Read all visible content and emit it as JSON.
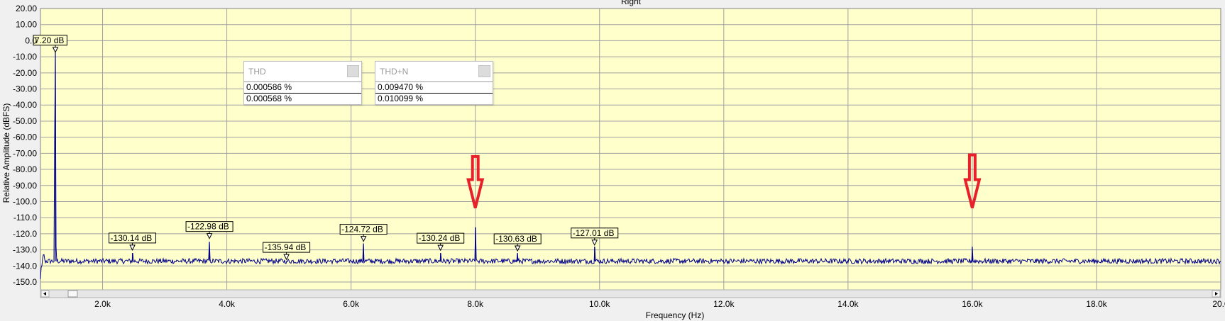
{
  "chart_data": {
    "type": "line",
    "title": "Right",
    "xlabel": "Frequency (Hz)",
    "ylabel": "Relative Amplitude (dBFS)",
    "xlim": [
      1000,
      20000
    ],
    "ylim": [
      -150,
      20
    ],
    "grid": true,
    "x_ticks": [
      2000,
      4000,
      6000,
      8000,
      10000,
      12000,
      14000,
      16000,
      18000,
      20000
    ],
    "x_tick_labels": [
      "2.0k",
      "4.0k",
      "6.0k",
      "8.0k",
      "10.0k",
      "12.0k",
      "14.0k",
      "16.0k",
      "18.0k",
      "20.0"
    ],
    "y_ticks": [
      20,
      10,
      0,
      -10,
      -20,
      -30,
      -40,
      -50,
      -60,
      -70,
      -80,
      -90,
      -100,
      -110,
      -120,
      -130,
      -140,
      -150
    ],
    "y_tick_labels": [
      "20.00",
      "10.00",
      "0.0",
      "-10.00",
      "-20.00",
      "-30.00",
      "-40.00",
      "-50.00",
      "-60.00",
      "-70.00",
      "-80.00",
      "-90.00",
      "-100.0",
      "-110.0",
      "-120.0",
      "-130.0",
      "-140.0",
      "-150.0"
    ],
    "noise_floor": -137,
    "series": [
      {
        "color": "#00008b",
        "peaks": [
          {
            "x": 1240,
            "y": -7.2
          },
          {
            "x": 2480,
            "y": -132
          },
          {
            "x": 3720,
            "y": -125
          },
          {
            "x": 4960,
            "y": -137
          },
          {
            "x": 6200,
            "y": -126
          },
          {
            "x": 7440,
            "y": -132
          },
          {
            "x": 8000,
            "y": -116
          },
          {
            "x": 8680,
            "y": -132
          },
          {
            "x": 9920,
            "y": -128
          },
          {
            "x": 16000,
            "y": -128
          }
        ]
      }
    ],
    "peak_labels": [
      {
        "x": 1240,
        "y": -7.2,
        "text": "7.20 dB"
      },
      {
        "x": 2480,
        "y": -130.14,
        "text": "-130.14 dB"
      },
      {
        "x": 3720,
        "y": -122.98,
        "text": "-122.98 dB"
      },
      {
        "x": 4960,
        "y": -135.94,
        "text": "-135.94 dB"
      },
      {
        "x": 6200,
        "y": -124.72,
        "text": "-124.72 dB"
      },
      {
        "x": 7440,
        "y": -130.24,
        "text": "-130.24 dB"
      },
      {
        "x": 8680,
        "y": -130.63,
        "text": "-130.63 dB"
      },
      {
        "x": 9920,
        "y": -127.01,
        "text": "-127.01 dB"
      }
    ],
    "annotation_arrows": [
      {
        "x": 8000,
        "y_top": -72,
        "y_tip": -104
      },
      {
        "x": 16000,
        "y_top": -71,
        "y_tip": -104
      }
    ],
    "colors": {
      "plot_background": "#ffffcc",
      "grid": "#a0a0a0",
      "trace": "#00008b",
      "arrow": "#e8202a"
    }
  },
  "meters": [
    {
      "title": "THD",
      "values": [
        "0.000586 %",
        "0.000568 %"
      ]
    },
    {
      "title": "THD+N",
      "values": [
        "0.009470 %",
        "0.010099 %"
      ]
    }
  ]
}
